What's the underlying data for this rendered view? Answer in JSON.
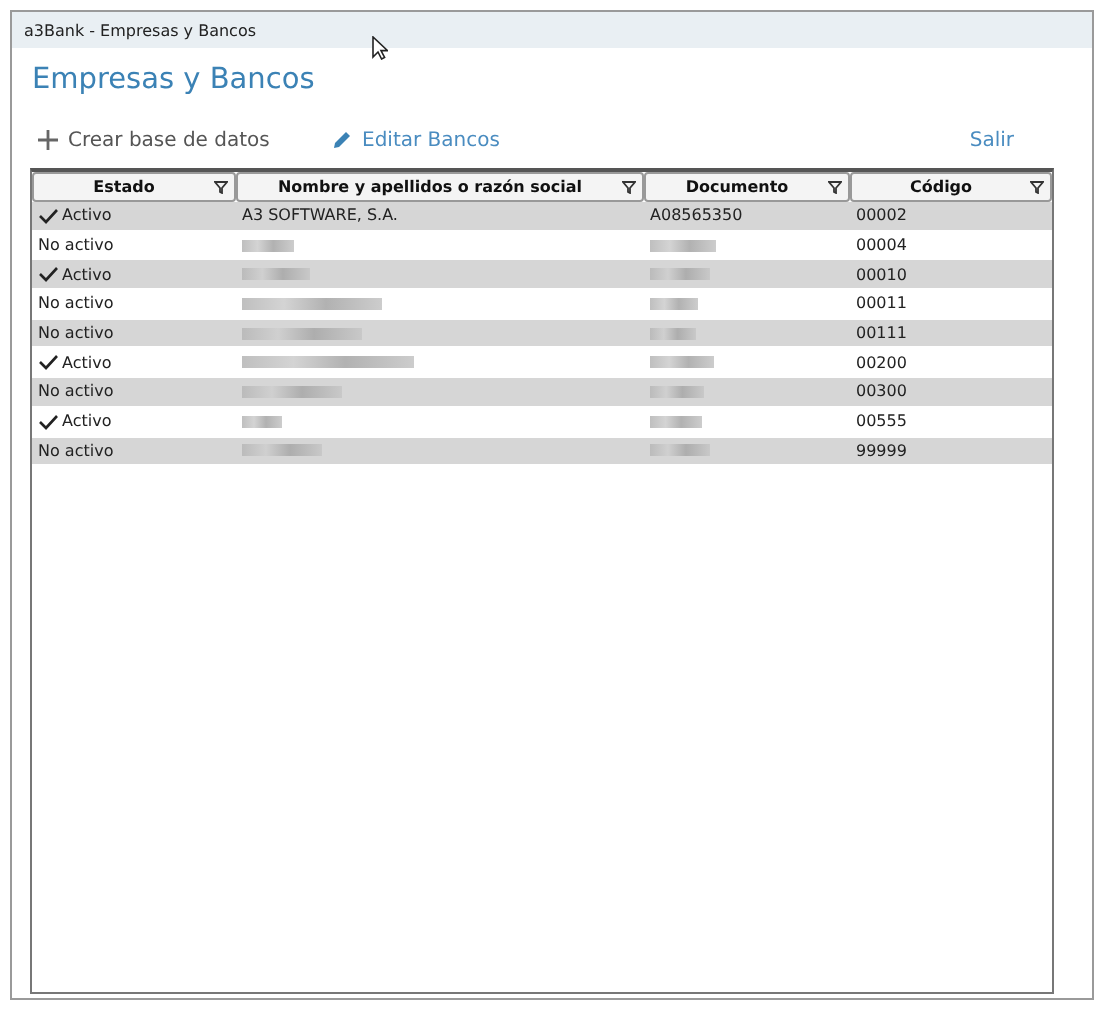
{
  "window": {
    "title": "a3Bank - Empresas y Bancos"
  },
  "heading": "Empresas y Bancos",
  "toolbar": [
    {
      "kind": "add",
      "label": "Crear base de datos"
    },
    {
      "kind": "edit",
      "label": "Editar Bancos"
    },
    {
      "kind": "exit",
      "label": "Salir"
    }
  ],
  "table": {
    "columns": [
      "Estado",
      "Nombre y apellidos o razón social",
      "Documento",
      "Código"
    ],
    "rows": [
      {
        "active": true,
        "status": "Activo",
        "redacted": false,
        "name": "A3 SOFTWARE, S.A.",
        "document": "A08565350",
        "code": "00002"
      },
      {
        "active": false,
        "status": "No activo",
        "redacted": true,
        "code": "00004"
      },
      {
        "active": true,
        "status": "Activo",
        "redacted": true,
        "code": "00010"
      },
      {
        "active": false,
        "status": "No activo",
        "redacted": true,
        "code": "00011"
      },
      {
        "active": false,
        "status": "No activo",
        "redacted": true,
        "code": "00111"
      },
      {
        "active": true,
        "status": "Activo",
        "redacted": true,
        "code": "00200"
      },
      {
        "active": false,
        "status": "No activo",
        "redacted": true,
        "code": "00300"
      },
      {
        "active": true,
        "status": "Activo",
        "redacted": true,
        "code": "00555"
      },
      {
        "active": false,
        "status": "No activo",
        "redacted": true,
        "code": "99999"
      }
    ]
  }
}
